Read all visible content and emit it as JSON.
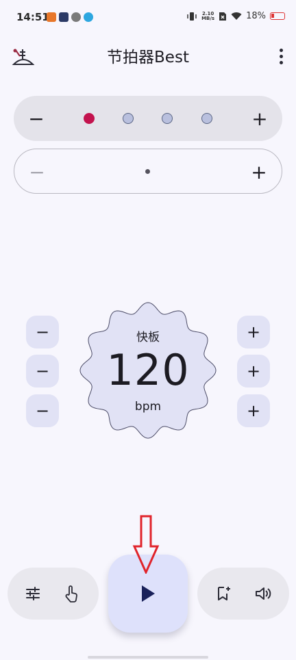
{
  "status_bar": {
    "time": "14:51",
    "net_speed_value": "2.10",
    "net_speed_unit": "MB/s",
    "battery": "18%"
  },
  "app_bar": {
    "title": "节拍器Best",
    "logo_icon": "metronome-logo-icon",
    "menu_icon": "more-vert-icon"
  },
  "beats": {
    "decrement_label": "−",
    "increment_label": "+",
    "dots": [
      "accent",
      "normal",
      "normal",
      "normal"
    ],
    "accent_color": "#c3134e",
    "normal_color": "#b9c0de"
  },
  "subdivision": {
    "decrement_label": "−",
    "increment_label": "+",
    "pattern": "single-dot"
  },
  "tempo": {
    "name": "快板",
    "value": "120",
    "unit": "bpm",
    "minus_label": "−",
    "plus_label": "+"
  },
  "bottom_bar": {
    "left_icons": [
      "tune-sliders-icon",
      "tap-tempo-icon"
    ],
    "play_icon": "play-icon",
    "right_icons": [
      "bookmark-add-icon",
      "volume-icon"
    ]
  },
  "colors": {
    "background": "#f7f6fd",
    "accent": "#c3134e",
    "play_button_bg": "#dee1fb",
    "annotation_arrow": "#e0242b",
    "stepper_bg": "#e1e2f5"
  }
}
